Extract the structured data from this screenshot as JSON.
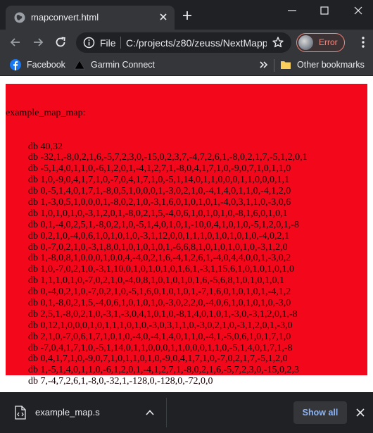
{
  "tab": {
    "title": "mapconvert.html",
    "favicon": "globe-icon",
    "close_icon": "close-icon"
  },
  "new_tab_icon": "plus-icon",
  "window_controls": [
    "minimize-icon",
    "maximize-icon",
    "close-icon"
  ],
  "toolbar": {
    "back_icon": "back-arrow-icon",
    "forward_icon": "forward-arrow-icon",
    "reload_icon": "reload-icon",
    "scheme": "File",
    "url": "C:/projects/z80/zeuss/NextMapper/mapconvert.html",
    "bookmark_icon": "star-icon",
    "profile_status": "Error",
    "menu_icon": "kebab-menu-icon"
  },
  "bookmarks": {
    "items": [
      {
        "label": "Facebook",
        "icon": "facebook-icon"
      },
      {
        "label": "Garmin Connect",
        "icon": "garmin-icon"
      }
    ],
    "overflow_icon": "chevron-double-right-icon",
    "other_label": "Other bookmarks",
    "other_icon": "folder-icon"
  },
  "page": {
    "label": "example_map_map:",
    "lines": [
      "db 40,32",
      "db -32,1,-8,0,2,1,6,-5,7,2,3,0,-15,0,2,3,7,-4,7,2,6,1,-8,0,2,1,7,-5,1,2,0,1",
      "db -5,1,4,0,1,1,0,-6,1,2,0,1,-4,1,2,7,1,-8,0,4,1,7,1,0,-9,0,7,1,0,1,1,0",
      "db 1,0,-9,0,4,1,7,1,0,-7,0,4,1,7,1,0,-5,1,14,0,1,1,0,0,0,1,1,0,0,0,1,1",
      "db 0,-5,1,4,0,1,7,1,-8,0,5,1,0,0,0,1,-3,0,2,1,0,-4,1,4,0,1,1,0,-4,1,2,0",
      "db 1,-3,0,5,1,0,0,0,1,-8,0,2,1,0,-3,1,6,0,1,0,1,0,1,-4,0,3,1,1,0,-3,0,6",
      "db 1,0,1,0,1,0,-3,1,2,0,1,-8,0,2,1,5,-4,0,6,1,0,1,0,1,0,-8,1,6,0,1,0,1",
      "db 0,1,-4,0,2,5,1,-8,0,2,1,0,-5,1,4,0,1,0,1,-10,0,4,1,0,1,0,-5,1,2,0,1,-8",
      "db 0,2,1,0,-4,0,6,1,0,1,0,1,0,-3,1,12,0,0,1,1,1,0,1,0,1,0,1,0,-4,0,2,1",
      "db 0,-7,0,2,1,0,-3,1,8,0,1,0,1,0,1,0,1,-6,6,8,1,0,1,0,1,0,1,0,-3,1,2,0",
      "db 1,-8,0,8,1,0,0,0,1,0,0,4,-4,0,2,1,6,-4,1,2,6,1,-4,0,4,4,0,0,1,-3,0,2",
      "db 1,0,-7,0,2,1,0,-3,1,10,0,1,0,1,0,1,0,1,6,1,-3,1,15,6,1,0,1,0,1,0,1,0",
      "db 1,1,1,0,1,0,-7,0,2,1,0,-4,0,8,1,0,1,0,1,0,1,6,-5,6,8,1,0,1,0,1,0,1",
      "db 0,-4,0,2,1,0,-7,0,2,1,0,-5,1,6,0,1,0,1,0,1,-7,1,6,0,1,0,1,0,1,-4,1,2",
      "db 0,1,-8,0,2,1,5,-4,0,6,1,0,1,0,1,0,-3,0,2,2,0,-4,0,6,1,0,1,0,1,0,-3,0",
      "db 2,5,1,-8,0,2,1,0,-3,1,-3,0,4,1,0,1,0,-8,1,4,0,1,0,1,-3,0,-3,1,2,0,1,-8",
      "db 0,12,1,0,0,0,1,0,1,1,1,0,1,0,-3,0,3,1,1,0,-3,0,2,1,0,-3,1,2,0,1,-3,0",
      "db 2,1,0,-7,0,6,1,7,1,0,1,0,-4,0,-4,1,4,0,1,1,0,-4,1,-5,0,6,1,0,1,7,1,0",
      "db -7,0,4,1,7,1,0,-5,1,14,0,1,1,0,0,0,1,1,0,0,0,1,1,0,-5,1,4,0,1,7,1,-8",
      "db 0,4,1,7,1,0,-9,0,7,1,0,1,1,0,1,0,-9,0,4,1,7,1,0,-7,0,2,1,7,-5,1,2,0",
      "db 1,-5,1,4,0,1,1,0,-6,1,2,0,1,-4,1,2,7,1,-8,0,2,1,6,-5,7,2,3,0,-15,0,2,3",
      "db 7,-4,7,2,6,1,-8,0,-32,1,-128,0,-128,0,-72,0,0"
    ]
  },
  "colors": {
    "page_block": "#f2071b",
    "show_all": "#8ab4f8",
    "error": "#f28b82"
  },
  "downloads": {
    "file_name": "example_map.s",
    "file_icon": "file-code-icon",
    "caret_icon": "caret-up-icon",
    "show_all_label": "Show all",
    "close_icon": "close-icon"
  }
}
